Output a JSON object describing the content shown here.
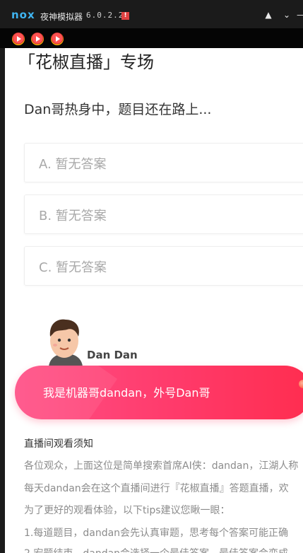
{
  "emulator": {
    "logo": "nox",
    "title": "夜神模拟器",
    "version": "6.0.2.2",
    "alert": "!"
  },
  "page": {
    "title": "「花椒直播」专场",
    "question": "Dan哥热身中，题目还在路上...",
    "options": [
      {
        "label": "A. 暂无答案"
      },
      {
        "label": "B. 暂无答案"
      },
      {
        "label": "C. 暂无答案"
      }
    ],
    "host_name": "Dan Dan",
    "banner_text": "我是机器哥dandan，外号Dan哥",
    "notice_title": "直播间观看须知",
    "notice_lines": [
      "各位观众，上面这位是简单搜索首席AI侠：dandan，江湖人称",
      "每天dandan会在这个直播间进行『花椒直播』答题直播，欢",
      "为了更好的观看体验，以下tips建议您瞅一眼：",
      "1.每道题目，dandan会先认真审题，思考每个答案可能正确",
      "2.宏题结束，dandan会选择一个最佳答案，最佳答案会变成"
    ]
  }
}
